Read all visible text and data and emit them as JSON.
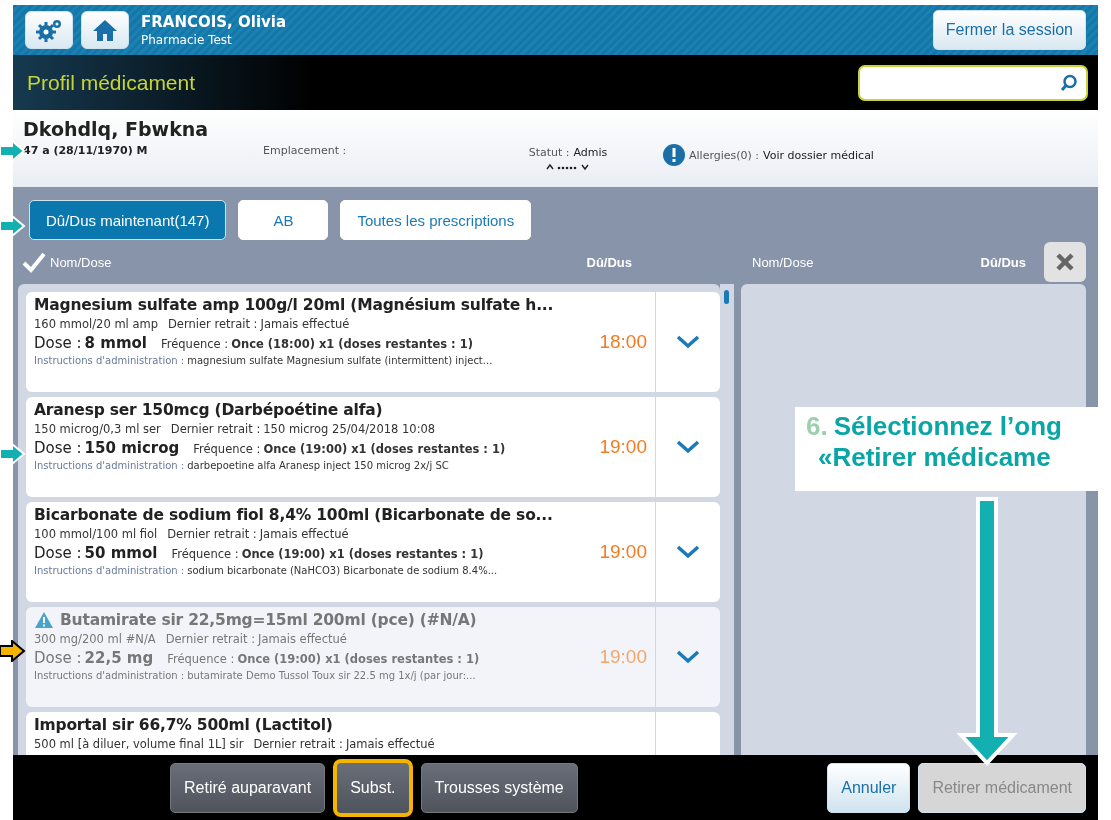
{
  "user": {
    "name": "FRANCOIS, Olivia",
    "site": "Pharmacie Test"
  },
  "logout_button": "Fermer la session",
  "screen_title": "Profil médicament",
  "patient": {
    "name": "Dkohdlq, Fbwkna",
    "age_line": "47 a (28/11/1970) M",
    "location_label": "Emplacement :",
    "status_label": "Statut :",
    "status_value": "Admis",
    "allergies_label": "Allergies(0) :",
    "allergies_link": "Voir dossier médical"
  },
  "tabs": [
    {
      "label": "Dû/Dus maintenant(147)",
      "selected": true
    },
    {
      "label": "AB",
      "selected": false
    },
    {
      "label": "Toutes les prescriptions",
      "selected": false
    }
  ],
  "left_columns": [
    "Nom/Dose",
    "Dû/Dus"
  ],
  "right_columns": [
    "Nom/Dose",
    "Dû/Dus"
  ],
  "cards": [
    {
      "title": "Magnesium sulfate amp 100g/l 20ml (Magnésium sulfate h...",
      "warning": false,
      "disabled": false,
      "strength": "160 mmol/20 ml amp",
      "last_label": "Dernier retrait :",
      "last_value": "Jamais effectué",
      "dose_label": "Dose :",
      "dose_value": "8 mmol",
      "freq_label": "Fréquence :",
      "freq_value": "Once (18:00) x1 (doses restantes : 1)",
      "instr_label": "Instructions d'administration :",
      "instr_value": "magnesium sulfate Magnesium sulfate (intermittent) inject...",
      "time": "18:00"
    },
    {
      "title": "Aranesp ser 150mcg (Darbépoétine alfa)",
      "warning": false,
      "disabled": false,
      "strength": "150 microg/0,3 ml ser",
      "last_label": "Dernier retrait :",
      "last_value": "150 microg 25/04/2018 10:08",
      "dose_label": "Dose :",
      "dose_value": "150 microg",
      "freq_label": "Fréquence :",
      "freq_value": "Once (19:00) x1 (doses restantes : 1)",
      "instr_label": "Instructions d'administration :",
      "instr_value": "darbepoetine alfa Aranesp inject  150 microg  2x/j SC",
      "time": "19:00"
    },
    {
      "title": "Bicarbonate de sodium fiol 8,4% 100ml (Bicarbonate de so...",
      "warning": false,
      "disabled": false,
      "strength": "100 mmol/100 ml fiol",
      "last_label": "Dernier retrait :",
      "last_value": "Jamais effectué",
      "dose_label": "Dose :",
      "dose_value": "50 mmol",
      "freq_label": "Fréquence :",
      "freq_value": "Once (19:00) x1 (doses restantes : 1)",
      "instr_label": "Instructions d'administration :",
      "instr_value": "sodium bicarbonate (NaHCO3) Bicarbonate de sodium 8.4%...",
      "time": "19:00"
    },
    {
      "title": "Butamirate sir 22,5mg=15ml 200ml (pce) (#N/A)",
      "warning": true,
      "disabled": true,
      "strength": "300 mg/200 ml #N/A",
      "last_label": "Dernier retrait :",
      "last_value": "Jamais effectué",
      "dose_label": "Dose :",
      "dose_value": "22,5 mg",
      "freq_label": "Fréquence :",
      "freq_value": "Once (19:00) x1 (doses restantes : 1)",
      "instr_label": "Instructions d'administration :",
      "instr_value": "butamirate Demo Tussol Toux sir 22.5 mg  1x/j  (par jour:...",
      "time": "19:00"
    },
    {
      "title": "Importal sir 66,7% 500ml (Lactitol)",
      "warning": false,
      "disabled": false,
      "strength": "500 ml [à diluer, volume final 1L] sir",
      "last_label": "Dernier retrait :",
      "last_value": "Jamais effectué"
    }
  ],
  "bottom_buttons": [
    {
      "label": "Retiré auparavant",
      "kind": "dark",
      "highlighted": false,
      "disabled": false
    },
    {
      "label": "Subst.",
      "kind": "dark",
      "highlighted": true,
      "disabled": false
    },
    {
      "label": "Trousses système",
      "kind": "dark",
      "highlighted": false,
      "disabled": false
    },
    {
      "label": "Annuler",
      "kind": "light",
      "highlighted": false,
      "disabled": false
    },
    {
      "label": "Retirer médicament",
      "kind": "light",
      "highlighted": false,
      "disabled": true
    }
  ],
  "callout": {
    "number": "6.",
    "lines": [
      "Sélectionnez l’ong",
      "«Retirer médicame"
    ]
  },
  "pointers": [
    {
      "kind": "step"
    },
    {
      "kind": "step"
    },
    {
      "kind": "step"
    },
    {
      "kind": "alert"
    }
  ]
}
